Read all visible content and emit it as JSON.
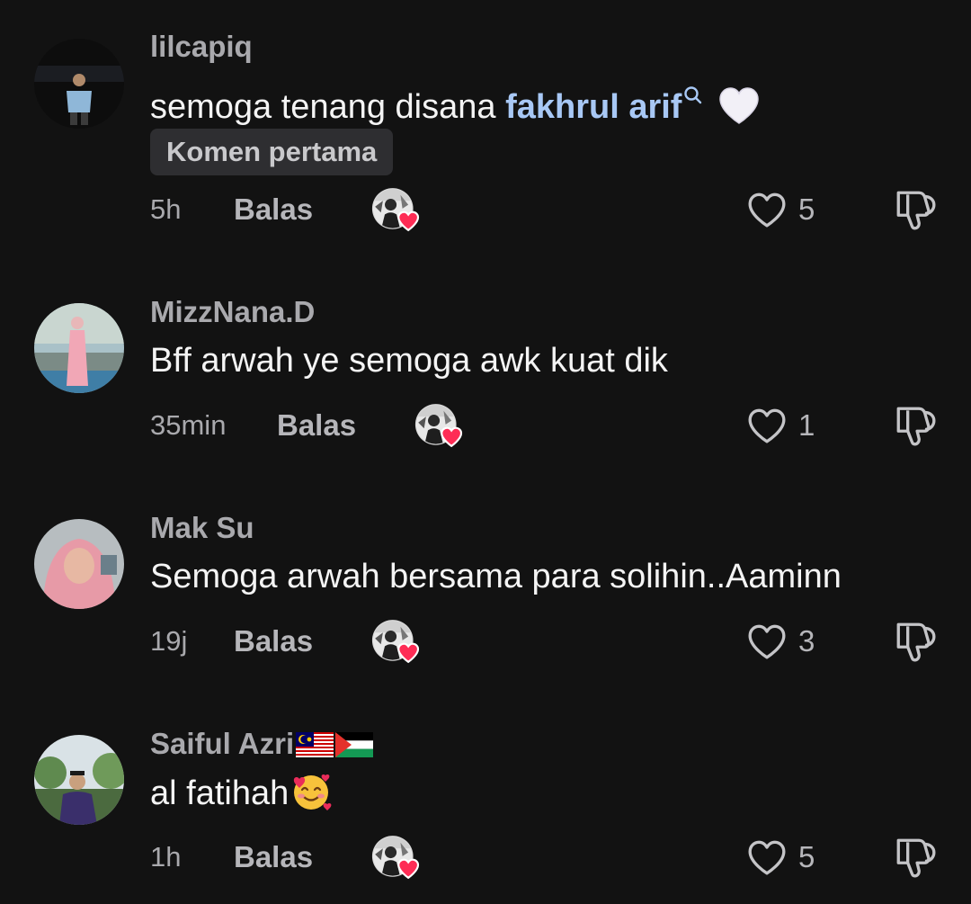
{
  "comments": [
    {
      "username": "lilcapiq",
      "text_prefix": "semoga tenang disana ",
      "mention": "fakhrul arif",
      "emoji": "white-heart",
      "badge": "Komen pertama",
      "time": "5h",
      "reply_label": "Balas",
      "likes": "5"
    },
    {
      "username": "MizzNana.D",
      "text": "Bff arwah ye semoga awk kuat dik",
      "time": "35min",
      "reply_label": "Balas",
      "likes": "1"
    },
    {
      "username": "Mak Su",
      "text": "Semoga arwah bersama para solihin..Aaminn",
      "time": "19j",
      "reply_label": "Balas",
      "likes": "3"
    },
    {
      "username": "Saiful Azri",
      "flags": [
        "malaysia-flag",
        "palestine-flag"
      ],
      "text": "al fatihah",
      "emoji": "smiling-face-with-hearts",
      "time": "1h",
      "reply_label": "Balas",
      "likes": "5"
    }
  ],
  "icons": {
    "like": "heart-outline-icon",
    "dislike": "thumbs-down-icon",
    "creator_liked": "creator-avatar-with-heart-icon",
    "mention_search": "search-icon"
  },
  "colors": {
    "background": "#121212",
    "username": "#a9a9ad",
    "mention": "#a8c8f5",
    "heart_badge": "#fe2c55"
  }
}
